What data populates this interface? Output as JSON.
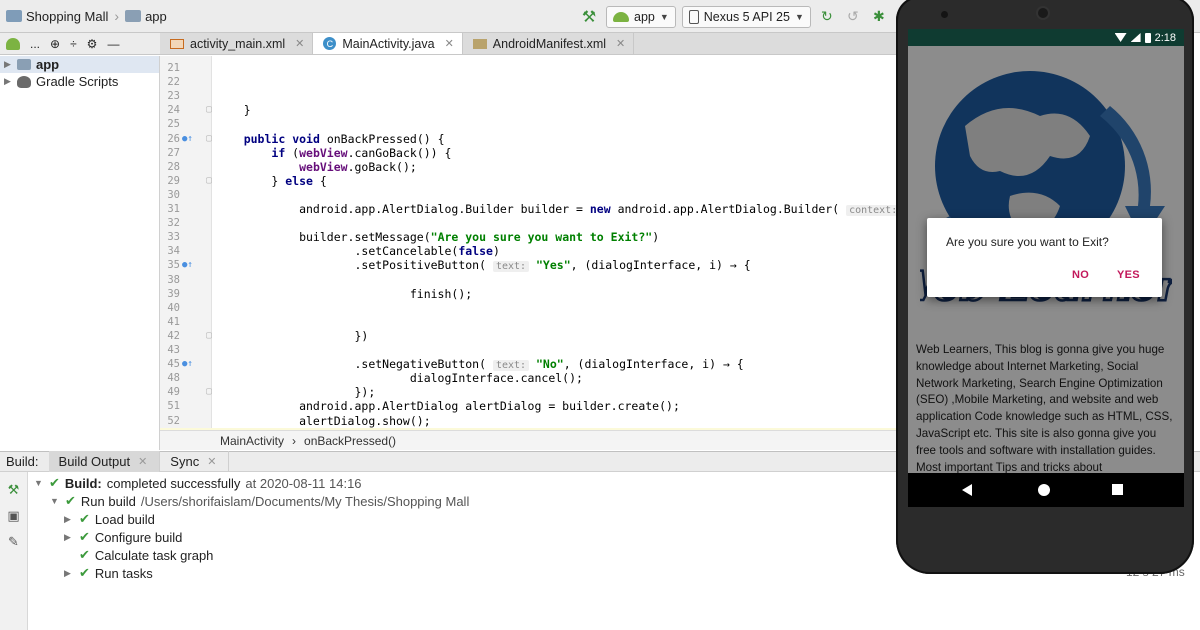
{
  "breadcrumb": {
    "project": "Shopping Mall",
    "module": "app"
  },
  "toolbar": {
    "run_config": "app",
    "device": "Nexus 5 API 25"
  },
  "project_panel": {
    "view_label": "...",
    "tree": [
      {
        "label": "app"
      },
      {
        "label": "Gradle Scripts"
      }
    ]
  },
  "editor_tabs": [
    {
      "label": "activity_main.xml"
    },
    {
      "label": "MainActivity.java"
    },
    {
      "label": "AndroidManifest.xml"
    }
  ],
  "editor_breadcrumb": {
    "class": "MainActivity",
    "method": "onBackPressed()"
  },
  "code_lines": [
    {
      "ln": "21",
      "text": ""
    },
    {
      "ln": "22",
      "text": ""
    },
    {
      "ln": "23",
      "text": ""
    },
    {
      "ln": "24",
      "text": "    }"
    },
    {
      "ln": "25",
      "text": ""
    },
    {
      "ln": "26",
      "text": "    public void onBackPressed() {"
    },
    {
      "ln": "27",
      "text": "        if (webView.canGoBack()) {"
    },
    {
      "ln": "28",
      "text": "            webView.goBack();"
    },
    {
      "ln": "29",
      "text": "        } else {"
    },
    {
      "ln": "30",
      "text": ""
    },
    {
      "ln": "31",
      "text": "            android.app.AlertDialog.Builder builder = new android.app.AlertDialog.Builder( context: this);"
    },
    {
      "ln": "32",
      "text": ""
    },
    {
      "ln": "33",
      "text": "            builder.setMessage(\"Are you sure you want to Exit?\")"
    },
    {
      "ln": "34",
      "text": "                    .setCancelable(false)"
    },
    {
      "ln": "35",
      "text": "                    .setPositiveButton( text: \"Yes\", (dialogInterface, i) → {"
    },
    {
      "ln": "38",
      "text": ""
    },
    {
      "ln": "39",
      "text": "                            finish();"
    },
    {
      "ln": "40",
      "text": ""
    },
    {
      "ln": "41",
      "text": ""
    },
    {
      "ln": "42",
      "text": "                    })"
    },
    {
      "ln": "43",
      "text": ""
    },
    {
      "ln": "45",
      "text": "                    .setNegativeButton( text: \"No\", (dialogInterface, i) → {"
    },
    {
      "ln": "48",
      "text": "                            dialogInterface.cancel();"
    },
    {
      "ln": "49",
      "text": "                    });"
    },
    {
      "ln": "51",
      "text": "            android.app.AlertDialog alertDialog = builder.create();"
    },
    {
      "ln": "52",
      "text": "            alertDialog.show();"
    },
    {
      "ln": "53",
      "text": "        }"
    }
  ],
  "build_panel": {
    "label": "Build:",
    "tabs": [
      {
        "label": "Build Output"
      },
      {
        "label": "Sync"
      }
    ],
    "status_bold": "Build:",
    "status_text": "completed successfully",
    "status_time": "at 2020-08-11 14:16",
    "run_build_label": "Run build",
    "run_build_path": "/Users/shorifaislam/Documents/My Thesis/Shopping Mall",
    "steps": [
      {
        "label": "Load build"
      },
      {
        "label": "Configure build"
      },
      {
        "label": "Calculate task graph"
      },
      {
        "label": "Run tasks"
      }
    ],
    "elapsed": "12 s 27 ms"
  },
  "phone": {
    "status_time": "2:18",
    "dialog_message": "Are you sure you want to Exit?",
    "dialog_no": "NO",
    "dialog_yes": "YES",
    "logo_text": "Web Learners",
    "web_text": "Web Learners, This blog is gonna give you huge knowledge about Internet Marketing, Social Network Marketing, Search Engine Optimization (SEO) ,Mobile Marketing, and website and web application Code knowledge such as HTML, CSS, JavaScript etc. This site is also gonna give you free tools and software with installation guides. Most important Tips and tricks about"
  },
  "colors": {
    "string_green": "#008000",
    "keyword_navy": "#000080",
    "dialog_button": "#c2185b",
    "status_bar": "#0f3b31",
    "success_green": "#3c9a3c"
  }
}
